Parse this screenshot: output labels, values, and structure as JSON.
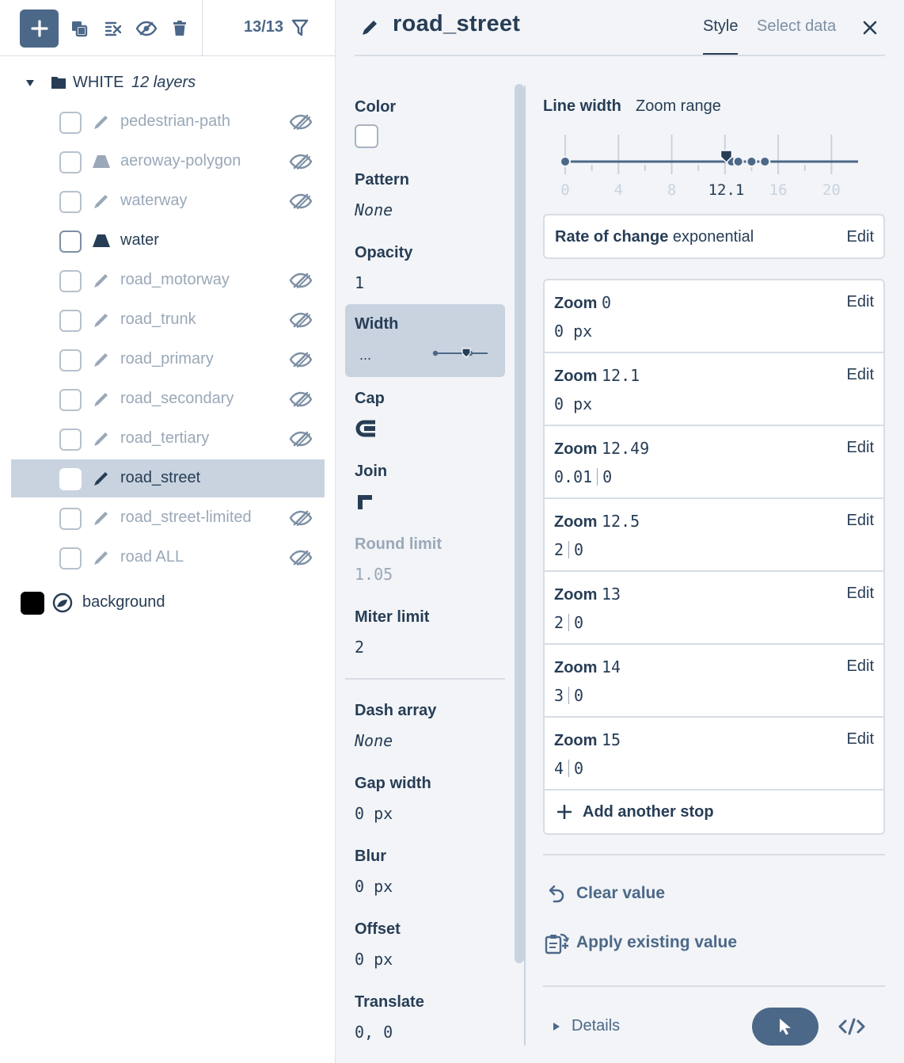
{
  "toolbar": {
    "layer_count": "13/13"
  },
  "group": {
    "name": "WHITE",
    "count_label": "12 layers"
  },
  "layers": [
    {
      "name": "pedestrian-path",
      "type": "line",
      "visible": false
    },
    {
      "name": "aeroway-polygon",
      "type": "fill",
      "visible": false
    },
    {
      "name": "waterway",
      "type": "line",
      "visible": false
    },
    {
      "name": "water",
      "type": "fill",
      "visible": true
    },
    {
      "name": "road_motorway",
      "type": "line",
      "visible": false
    },
    {
      "name": "road_trunk",
      "type": "line",
      "visible": false
    },
    {
      "name": "road_primary",
      "type": "line",
      "visible": false
    },
    {
      "name": "road_secondary",
      "type": "line",
      "visible": false
    },
    {
      "name": "road_tertiary",
      "type": "line",
      "visible": false
    },
    {
      "name": "road_street",
      "type": "line",
      "visible": true,
      "selected": true
    },
    {
      "name": "road_street-limited",
      "type": "line",
      "visible": false
    },
    {
      "name": "road ALL",
      "type": "line",
      "visible": false
    }
  ],
  "background_layer": {
    "name": "background",
    "color": "#000000"
  },
  "header": {
    "title": "road_street",
    "tab_style": "Style",
    "tab_select_data": "Select data"
  },
  "props": {
    "color": {
      "label": "Color",
      "value": "#ffffff"
    },
    "pattern": {
      "label": "Pattern",
      "value": "None"
    },
    "opacity": {
      "label": "Opacity",
      "value": "1"
    },
    "width": {
      "label": "Width",
      "value": "..."
    },
    "cap": {
      "label": "Cap"
    },
    "join": {
      "label": "Join"
    },
    "round_limit": {
      "label": "Round limit",
      "value": "1.05"
    },
    "miter_limit": {
      "label": "Miter limit",
      "value": "2"
    },
    "dash_array": {
      "label": "Dash array",
      "value": "None"
    },
    "gap_width": {
      "label": "Gap width",
      "value": "0 px"
    },
    "blur": {
      "label": "Blur",
      "value": "0 px"
    },
    "offset": {
      "label": "Offset",
      "value": "0 px"
    },
    "translate": {
      "label": "Translate",
      "value": "0, 0"
    }
  },
  "editor": {
    "title": "Line width",
    "subtitle": "Zoom range",
    "slider": {
      "min": 0,
      "max": 22,
      "tick_labels": [
        "0",
        "4",
        "8",
        "12.1",
        "16",
        "20"
      ],
      "tick_values": [
        0,
        4,
        8,
        12,
        16,
        20
      ],
      "current": 12.1,
      "stop_zooms": [
        0,
        12.1,
        12.49,
        12.5,
        13,
        14,
        15
      ]
    },
    "rate": {
      "label": "Rate of change",
      "value": "exponential",
      "edit": "Edit"
    },
    "stops": [
      {
        "zoom_word": "Zoom",
        "zoom": "0",
        "value": "0 px",
        "edit": "Edit"
      },
      {
        "zoom_word": "Zoom",
        "zoom": "12.1",
        "value": "0 px",
        "edit": "Edit"
      },
      {
        "zoom_word": "Zoom",
        "zoom": "12.49",
        "value_a": "0.01",
        "value_b": "0",
        "edit": "Edit"
      },
      {
        "zoom_word": "Zoom",
        "zoom": "12.5",
        "value_a": "2",
        "value_b": "0",
        "edit": "Edit"
      },
      {
        "zoom_word": "Zoom",
        "zoom": "13",
        "value_a": "2",
        "value_b": "0",
        "edit": "Edit"
      },
      {
        "zoom_word": "Zoom",
        "zoom": "14",
        "value_a": "3",
        "value_b": "0",
        "edit": "Edit"
      },
      {
        "zoom_word": "Zoom",
        "zoom": "15",
        "value_a": "4",
        "value_b": "0",
        "edit": "Edit"
      }
    ],
    "add_stop": "Add another stop",
    "clear_value": "Clear value",
    "apply_existing": "Apply existing value",
    "details": "Details"
  },
  "colors": {
    "accent": "#4c6888",
    "text": "#273d56",
    "muted": "#9aa8b8",
    "selected_bg": "#c9d3e0",
    "panel_bg": "#f2f4f7"
  }
}
